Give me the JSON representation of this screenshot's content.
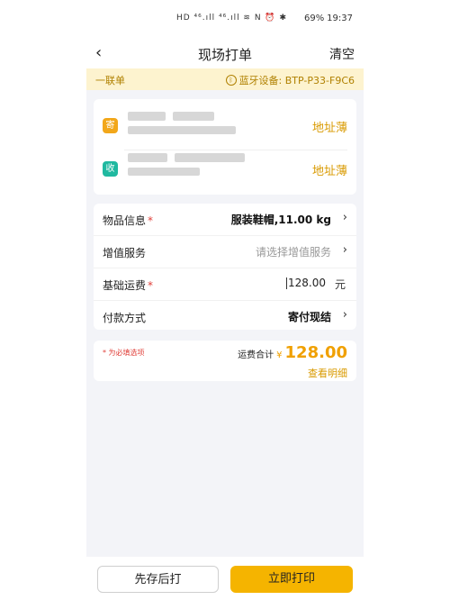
{
  "status_bar": {
    "signal_text": "HD ⁴⁶.ıll ⁴⁶.ıll ≋ N ⏰ ✱",
    "battery": "69%",
    "time": "19:37"
  },
  "nav": {
    "back_icon": "chevron-left-icon",
    "title": "现场打单",
    "clear_label": "清空"
  },
  "banner": {
    "order_type": "一联单",
    "bluetooth_label": "蓝牙设备: BTP-P33-F9C6"
  },
  "addresses": {
    "sender_badge": "寄",
    "receiver_badge": "收",
    "sender_link": "地址薄",
    "receiver_link": "地址薄"
  },
  "form": {
    "rows": [
      {
        "label": "物品信息",
        "required": "*",
        "value": "服装鞋帽,11.00 kg"
      },
      {
        "label": "增值服务",
        "required": "",
        "value": "请选择增值服务"
      },
      {
        "label": "基础运费",
        "required": "*",
        "value": "128.00",
        "unit": "元"
      },
      {
        "label": "付款方式",
        "required": "",
        "value": "寄付现结"
      }
    ]
  },
  "summary": {
    "required_note": "* 为必填选项",
    "total_label": "运费合计",
    "currency": "¥",
    "total_value": "128.00",
    "detail_link": "查看明细"
  },
  "actions": {
    "save_label": "先存后打",
    "print_label": "立即打印"
  },
  "colors": {
    "accent": "#f5b400",
    "banner_bg": "#fdf3cf",
    "send_badge": "#f2a71a",
    "receive_badge": "#20b9a0",
    "required": "#e0403a"
  }
}
